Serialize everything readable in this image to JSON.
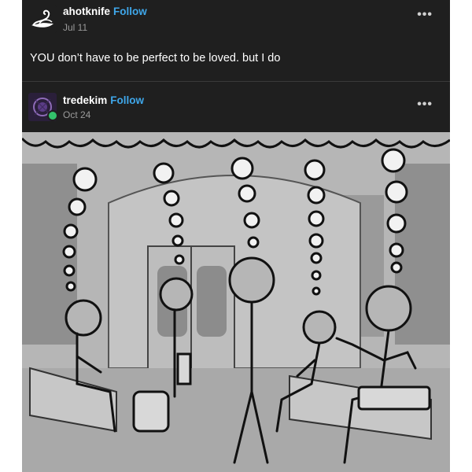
{
  "post1": {
    "username": "ahotknife",
    "follow_label": "Follow",
    "date": "Jul 11",
    "text": "YOU don’t have to be perfect to be loved. but I do",
    "more_icon": "more-horizontal-icon"
  },
  "post2": {
    "username": "tredekim",
    "follow_label": "Follow",
    "date": "Oct 24",
    "more_icon": "more-horizontal-icon",
    "badge_icon": "reblog-icon",
    "badge_color": "#33c26b"
  },
  "colors": {
    "background": "#1f1f1f",
    "accent": "#3fa7ea",
    "text": "#ffffff",
    "muted": "#9a9a9a"
  }
}
